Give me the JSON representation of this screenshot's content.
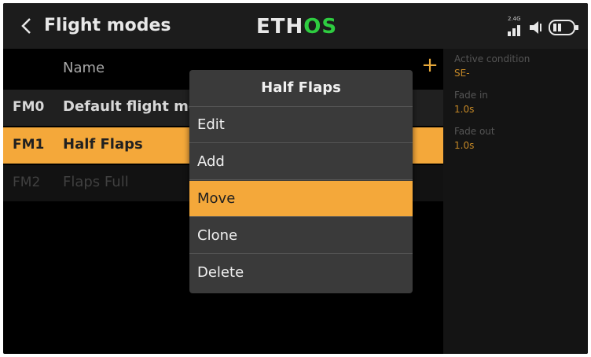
{
  "header": {
    "title": "Flight modes",
    "logo_white": "ETH",
    "logo_green": "OS",
    "radio_band": "2.4G"
  },
  "list": {
    "column_name": "Name",
    "add_label": "+",
    "rows": [
      {
        "code": "FM0",
        "name": "Default flight mc"
      },
      {
        "code": "FM1",
        "name": "Half Flaps"
      },
      {
        "code": "FM2",
        "name": "Flaps Full"
      }
    ]
  },
  "side_panel": {
    "active_condition_label": "Active condition",
    "active_condition_value": "SE-",
    "fade_in_label": "Fade in",
    "fade_in_value": "1.0s",
    "fade_out_label": "Fade out",
    "fade_out_value": "1.0s"
  },
  "menu": {
    "title": "Half Flaps",
    "items": [
      "Edit",
      "Add",
      "Move",
      "Clone",
      "Delete"
    ],
    "selected": "Move"
  },
  "colors": {
    "accent": "#f4a83a",
    "logo_green": "#2ecc40",
    "background": "#000000"
  }
}
